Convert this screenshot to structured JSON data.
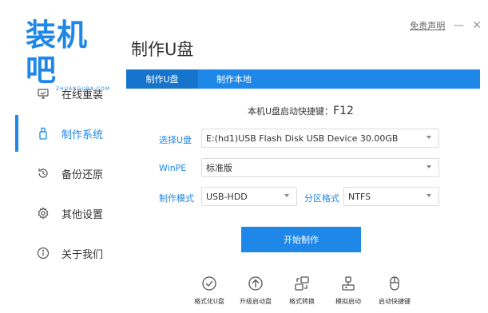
{
  "app": {
    "logo_text": "装机吧",
    "logo_sub": "ZHUANGJIBA.COM",
    "page_title": "制作U盘",
    "disclaimer": "免责声明",
    "minimize_glyph": "—",
    "close_glyph": "✕"
  },
  "sidebar": {
    "items": [
      {
        "label": "在线重装",
        "icon": "monitor-icon",
        "active": false
      },
      {
        "label": "制作系统",
        "icon": "usb-drive-icon",
        "active": true
      },
      {
        "label": "备份还原",
        "icon": "backup-restore-icon",
        "active": false
      },
      {
        "label": "其他设置",
        "icon": "gear-icon",
        "active": false
      },
      {
        "label": "关于我们",
        "icon": "info-icon",
        "active": false
      }
    ]
  },
  "tabs": [
    {
      "label": "制作U盘",
      "active": true
    },
    {
      "label": "制作本地",
      "active": false
    }
  ],
  "hotkey": {
    "prefix": "本机U盘启动快捷键：",
    "key": "F12"
  },
  "form": {
    "usb_label": "选择U盘",
    "usb_value": "E:(hd1)USB Flash Disk USB Device 30.00GB",
    "winpe_label": "WinPE",
    "winpe_value": "标准版",
    "mode_label": "制作模式",
    "mode_value": "USB-HDD",
    "partition_label": "分区格式",
    "partition_value": "NTFS"
  },
  "start_button": "开始制作",
  "tools": [
    {
      "label": "格式化U盘",
      "icon": "format-check-icon"
    },
    {
      "label": "升级启动盘",
      "icon": "upgrade-arrow-icon"
    },
    {
      "label": "格式转换",
      "icon": "convert-icon"
    },
    {
      "label": "模拟启动",
      "icon": "simulate-boot-icon"
    },
    {
      "label": "启动快捷键",
      "icon": "mouse-icon"
    }
  ],
  "colors": {
    "accent": "#1e87e8",
    "accent_dark": "#1674cc"
  }
}
